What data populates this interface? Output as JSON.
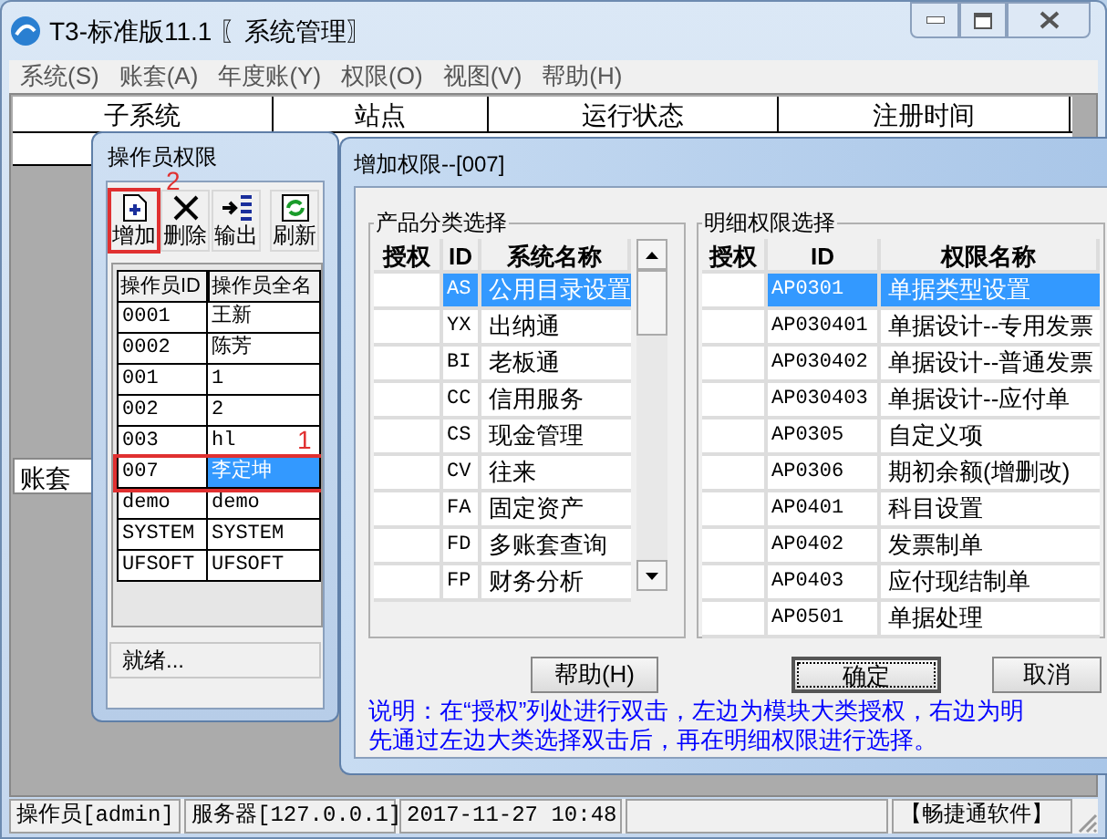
{
  "window": {
    "title": "T3-标准版11.1 〖系统管理〗"
  },
  "menu": [
    "系统(S)",
    "账套(A)",
    "年度账(Y)",
    "权限(O)",
    "视图(V)",
    "帮助(H)"
  ],
  "main_table": {
    "columns": [
      "子系统",
      "站点",
      "运行状态",
      "注册时间"
    ],
    "row_label": "账套"
  },
  "operator_window": {
    "title": "操作员权限",
    "toolbar": [
      {
        "kind": "add",
        "label": "增加",
        "outlined": true
      },
      {
        "kind": "delete",
        "label": "删除",
        "outlined": false
      },
      {
        "kind": "export",
        "label": "输出",
        "outlined": false
      },
      {
        "kind": "refresh",
        "label": "刷新",
        "outlined": false
      }
    ],
    "columns": [
      "操作员ID",
      "操作员全名"
    ],
    "rows": [
      {
        "id": "0001",
        "name": "王新",
        "selected": false,
        "outlined": false
      },
      {
        "id": "0002",
        "name": "陈芳",
        "selected": false,
        "outlined": false
      },
      {
        "id": "001",
        "name": "1",
        "selected": false,
        "outlined": false
      },
      {
        "id": "002",
        "name": "2",
        "selected": false,
        "outlined": false
      },
      {
        "id": "003",
        "name": "hl",
        "selected": false,
        "outlined": false
      },
      {
        "id": "007",
        "name": "李定坤",
        "selected": true,
        "outlined": true
      },
      {
        "id": "demo",
        "name": "demo",
        "selected": false,
        "outlined": false
      },
      {
        "id": "SYSTEM",
        "name": "SYSTEM",
        "selected": false,
        "outlined": false
      },
      {
        "id": "UFSOFT",
        "name": "UFSOFT",
        "selected": false,
        "outlined": false
      }
    ],
    "status": "就绪...",
    "markers": [
      "2",
      "1"
    ]
  },
  "dialog": {
    "title": "增加权限--[007]",
    "product_group": {
      "title": "产品分类选择",
      "columns": [
        "授权",
        "ID",
        "系统名称"
      ],
      "rows": [
        {
          "id": "AS",
          "name": "公用目录设置",
          "selected": true
        },
        {
          "id": "YX",
          "name": "出纳通",
          "selected": false
        },
        {
          "id": "BI",
          "name": "老板通",
          "selected": false
        },
        {
          "id": "CC",
          "name": "信用服务",
          "selected": false
        },
        {
          "id": "CS",
          "name": "现金管理",
          "selected": false
        },
        {
          "id": "CV",
          "name": "往来",
          "selected": false
        },
        {
          "id": "FA",
          "name": "固定资产",
          "selected": false
        },
        {
          "id": "FD",
          "name": "多账套查询",
          "selected": false
        },
        {
          "id": "FP",
          "name": "财务分析",
          "selected": false
        }
      ]
    },
    "detail_group": {
      "title": "明细权限选择",
      "columns": [
        "授权",
        "ID",
        "权限名称"
      ],
      "rows": [
        {
          "id": "AP0301",
          "name": "单据类型设置",
          "selected": true
        },
        {
          "id": "AP030401",
          "name": "单据设计--专用发票",
          "selected": false
        },
        {
          "id": "AP030402",
          "name": "单据设计--普通发票",
          "selected": false
        },
        {
          "id": "AP030403",
          "name": "单据设计--应付单",
          "selected": false
        },
        {
          "id": "AP0305",
          "name": "自定义项",
          "selected": false
        },
        {
          "id": "AP0306",
          "name": "期初余额(增删改)",
          "selected": false
        },
        {
          "id": "AP0401",
          "name": "科目设置",
          "selected": false
        },
        {
          "id": "AP0402",
          "name": "发票制单",
          "selected": false
        },
        {
          "id": "AP0403",
          "name": "应付现结制单",
          "selected": false
        },
        {
          "id": "AP0501",
          "name": "单据处理",
          "selected": false
        }
      ]
    },
    "buttons": [
      {
        "label": "帮助(H)",
        "default": false
      },
      {
        "label": "确定",
        "default": true
      },
      {
        "label": "取消",
        "default": false
      }
    ],
    "note": [
      "说明：在“授权”列处进行双击，左边为模块大类授权，右边为明",
      "先通过左边大类选择双击后，再在明细权限进行选择。"
    ]
  },
  "status_bar": [
    "操作员[admin]",
    "服务器[127.0.0.1]",
    "2017-11-27 10:48",
    "【畅捷通软件】"
  ]
}
